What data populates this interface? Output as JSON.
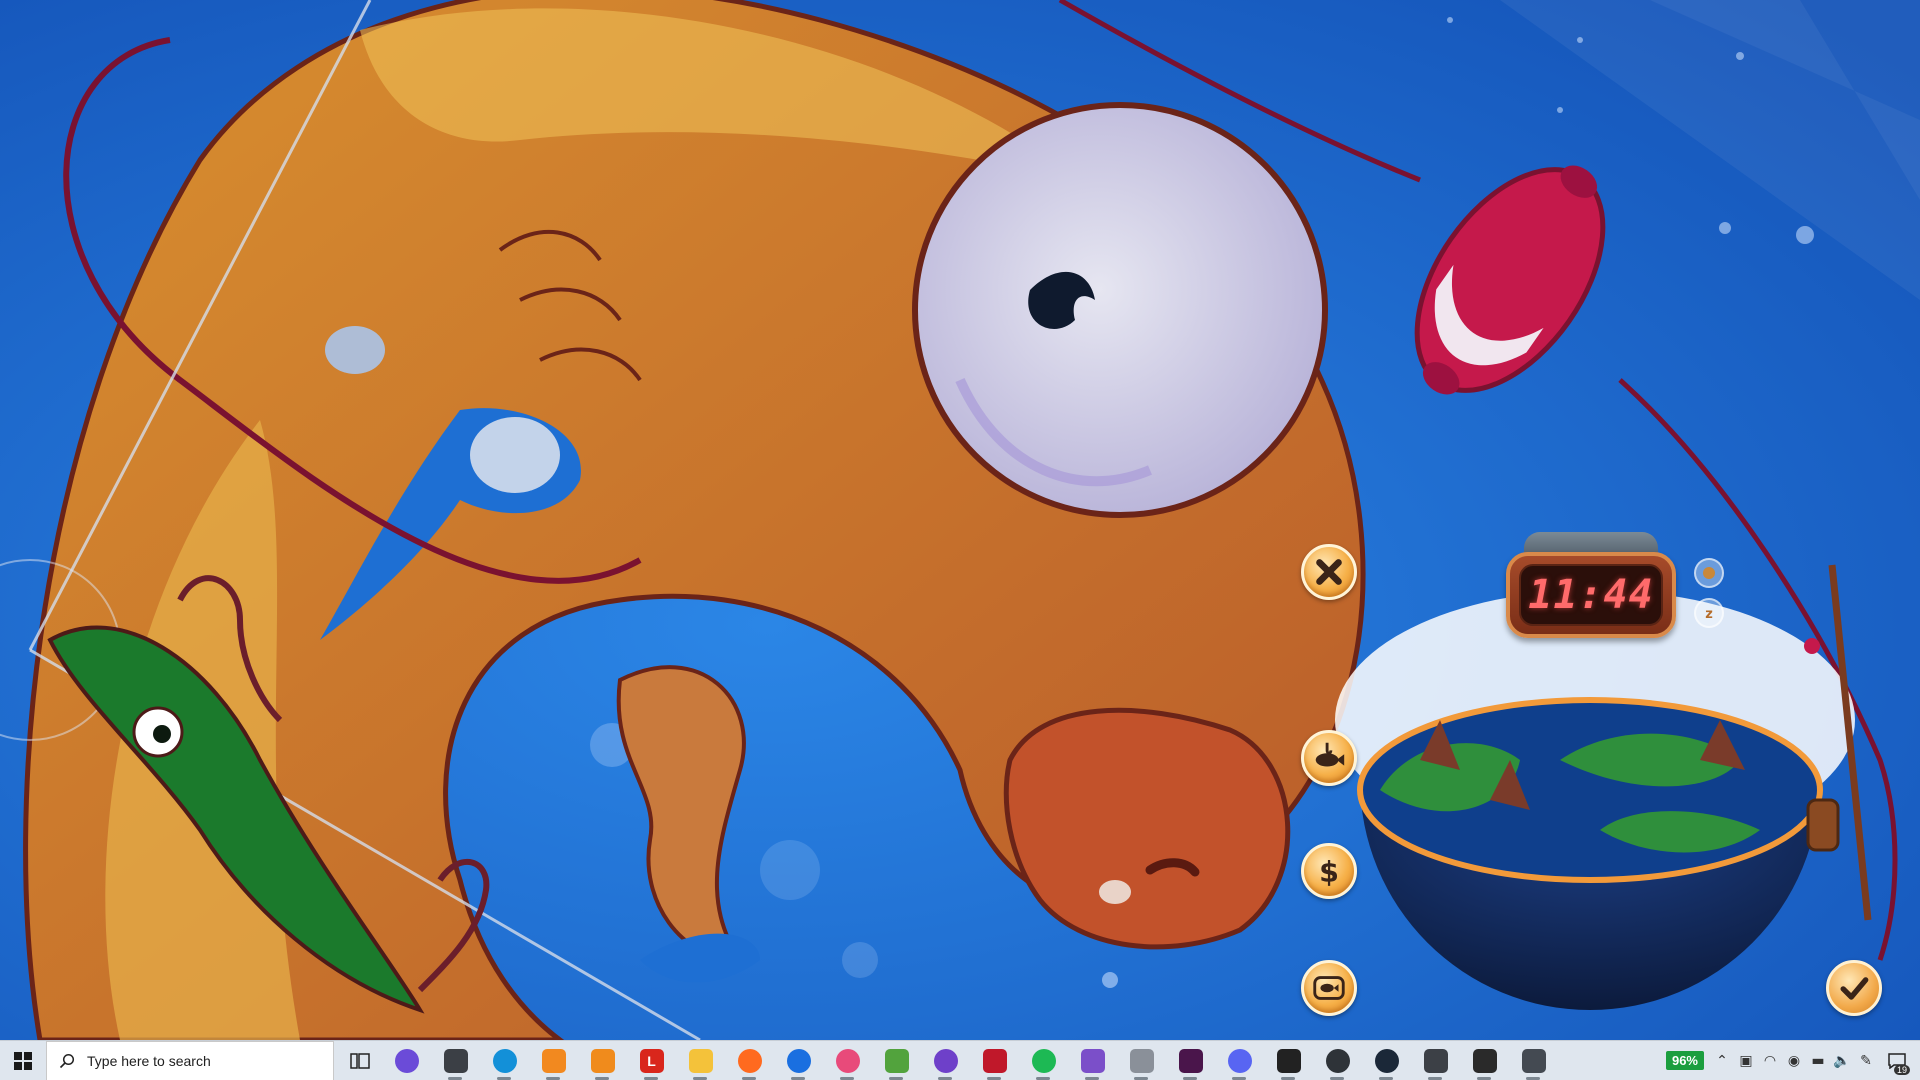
{
  "wallpaper": {
    "description_icon": "fishing-game-wallpaper",
    "colors": {
      "ocean": "#1f6bd3",
      "fish": "#e9a23a",
      "bobber": "#c5194b",
      "line": "#7a1230"
    }
  },
  "game_overlay": {
    "clock_time": "11:44",
    "side_buttons": [
      {
        "icon": "close-icon"
      },
      {
        "icon": "fish-hook-icon"
      },
      {
        "icon": "dollar-icon"
      },
      {
        "icon": "fish-tank-icon"
      }
    ],
    "mini_icons": [
      {
        "icon": "bait-icon"
      },
      {
        "icon": "sleep-icon"
      }
    ],
    "confirm_icon": "checkmark-icon"
  },
  "taskbar": {
    "search_placeholder": "Type here to search",
    "apps": [
      {
        "name": "copilot",
        "color": "#6b4bd8",
        "glyph": ""
      },
      {
        "name": "unity-hub",
        "color": "#3b3f45",
        "glyph": ""
      },
      {
        "name": "edge",
        "color": "#1390d8",
        "glyph": ""
      },
      {
        "name": "app-orange",
        "color": "#f2891f",
        "glyph": ""
      },
      {
        "name": "blender",
        "color": "#f08b1c",
        "glyph": ""
      },
      {
        "name": "app-l",
        "color": "#d9261c",
        "glyph": "L"
      },
      {
        "name": "file-explorer",
        "color": "#f4c23a",
        "glyph": ""
      },
      {
        "name": "firefox",
        "color": "#ff6a1f",
        "glyph": ""
      },
      {
        "name": "app-blue-circle",
        "color": "#1a6fe0",
        "glyph": ""
      },
      {
        "name": "app-pink",
        "color": "#e84a7a",
        "glyph": ""
      },
      {
        "name": "app-notepad",
        "color": "#52a33d",
        "glyph": ""
      },
      {
        "name": "github-desktop",
        "color": "#6e40c9",
        "glyph": ""
      },
      {
        "name": "mcafee",
        "color": "#c0182a",
        "glyph": ""
      },
      {
        "name": "spotify",
        "color": "#1db954",
        "glyph": ""
      },
      {
        "name": "visual-studio",
        "color": "#7b4fc9",
        "glyph": ""
      },
      {
        "name": "app-grey-swirl",
        "color": "#8a9099",
        "glyph": ""
      },
      {
        "name": "slack",
        "color": "#4a154b",
        "glyph": ""
      },
      {
        "name": "discord",
        "color": "#5865f2",
        "glyph": ""
      },
      {
        "name": "unity",
        "color": "#222222",
        "glyph": ""
      },
      {
        "name": "app-dark-circle",
        "color": "#2e3338",
        "glyph": ""
      },
      {
        "name": "steam",
        "color": "#1b2838",
        "glyph": ""
      },
      {
        "name": "unity-2",
        "color": "#3c4046",
        "glyph": ""
      },
      {
        "name": "app-hook",
        "color": "#2a2a2a",
        "glyph": ""
      },
      {
        "name": "unity-3",
        "color": "#444a52",
        "glyph": ""
      }
    ],
    "battery_percent": "96%",
    "notification_count": "19"
  }
}
